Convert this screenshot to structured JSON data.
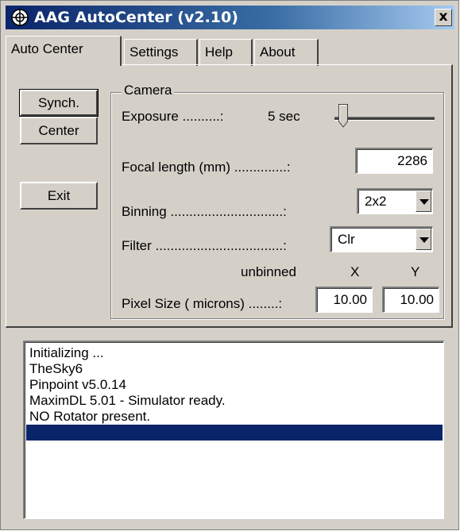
{
  "window": {
    "title": "AAG AutoCenter (v2.10)",
    "close_glyph": "x",
    "icon": "crosshair-globe-icon"
  },
  "tabs": [
    {
      "label": "Auto Center",
      "active": true
    },
    {
      "label": "Settings",
      "active": false
    },
    {
      "label": "Help",
      "active": false
    },
    {
      "label": "About",
      "active": false
    }
  ],
  "buttons": {
    "synch": "Synch.",
    "center": "Center",
    "exit": "Exit"
  },
  "camera": {
    "group_title": "Camera",
    "exposure_label": "Exposure ..........:",
    "exposure_value": "5 sec",
    "focal_label": "Focal length (mm) ..............:",
    "focal_value": "2286",
    "binning_label": "Binning ..............................:",
    "binning_value": "2x2",
    "filter_label": "Filter ..................................:",
    "filter_value": "Clr",
    "unbinned_label": "unbinned",
    "x_label": "X",
    "y_label": "Y",
    "pixel_label": "Pixel Size ( microns) ........:",
    "pixel_x": "10.00",
    "pixel_y": "10.00"
  },
  "log": {
    "lines": [
      "Initializing ...",
      "TheSky6",
      "Pinpoint v5.0.14",
      "MaximDL 5.01 - Simulator ready.",
      "NO Rotator present.",
      ""
    ],
    "selected_index": 5
  },
  "colors": {
    "titlebar_start": "#0a246a",
    "titlebar_end": "#a6caf0",
    "face": "#d4d0c8",
    "selection": "#0a246a"
  }
}
